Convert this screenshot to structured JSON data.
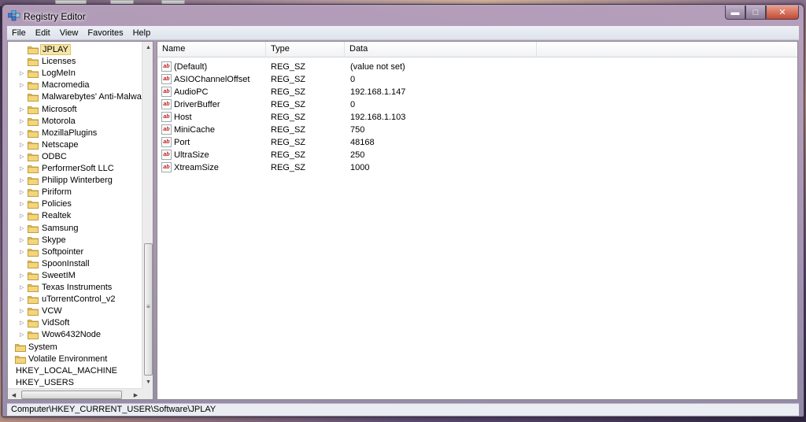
{
  "window": {
    "title": "Registry Editor"
  },
  "window_controls": {
    "minimize": "▬",
    "maximize": "□",
    "close": "✕"
  },
  "menu": [
    "File",
    "Edit",
    "View",
    "Favorites",
    "Help"
  ],
  "tree": [
    {
      "label": "JPLAY",
      "level": 1,
      "expandable": false,
      "selected": true
    },
    {
      "label": "Licenses",
      "level": 1,
      "expandable": false
    },
    {
      "label": "LogMeIn",
      "level": 1,
      "expandable": true
    },
    {
      "label": "Macromedia",
      "level": 1,
      "expandable": true
    },
    {
      "label": "Malwarebytes' Anti-Malware",
      "level": 1,
      "expandable": false
    },
    {
      "label": "Microsoft",
      "level": 1,
      "expandable": true
    },
    {
      "label": "Motorola",
      "level": 1,
      "expandable": true
    },
    {
      "label": "MozillaPlugins",
      "level": 1,
      "expandable": true
    },
    {
      "label": "Netscape",
      "level": 1,
      "expandable": true
    },
    {
      "label": "ODBC",
      "level": 1,
      "expandable": true
    },
    {
      "label": "PerformerSoft LLC",
      "level": 1,
      "expandable": true
    },
    {
      "label": "Philipp Winterberg",
      "level": 1,
      "expandable": true
    },
    {
      "label": "Piriform",
      "level": 1,
      "expandable": true
    },
    {
      "label": "Policies",
      "level": 1,
      "expandable": true
    },
    {
      "label": "Realtek",
      "level": 1,
      "expandable": true
    },
    {
      "label": "Samsung",
      "level": 1,
      "expandable": true
    },
    {
      "label": "Skype",
      "level": 1,
      "expandable": true
    },
    {
      "label": "Softpointer",
      "level": 1,
      "expandable": true
    },
    {
      "label": "SpoonInstall",
      "level": 1,
      "expandable": false
    },
    {
      "label": "SweetIM",
      "level": 1,
      "expandable": true
    },
    {
      "label": "Texas Instruments",
      "level": 1,
      "expandable": true
    },
    {
      "label": "uTorrentControl_v2",
      "level": 1,
      "expandable": true
    },
    {
      "label": "VCW",
      "level": 1,
      "expandable": true
    },
    {
      "label": "VidSoft",
      "level": 1,
      "expandable": true
    },
    {
      "label": "Wow6432Node",
      "level": 1,
      "expandable": true
    },
    {
      "label": "System",
      "level": 0,
      "expandable": false
    },
    {
      "label": "Volatile Environment",
      "level": 0,
      "expandable": false
    },
    {
      "label": "HKEY_LOCAL_MACHINE",
      "level": -1,
      "expandable": false
    },
    {
      "label": "HKEY_USERS",
      "level": -1,
      "expandable": false
    }
  ],
  "columns": [
    "Name",
    "Type",
    "Data"
  ],
  "values": [
    {
      "name": "(Default)",
      "type": "REG_SZ",
      "data": "(value not set)"
    },
    {
      "name": "ASIOChannelOffset",
      "type": "REG_SZ",
      "data": "0"
    },
    {
      "name": "AudioPC",
      "type": "REG_SZ",
      "data": "192.168.1.147"
    },
    {
      "name": "DriverBuffer",
      "type": "REG_SZ",
      "data": "0"
    },
    {
      "name": "Host",
      "type": "REG_SZ",
      "data": "192.168.1.103"
    },
    {
      "name": "MiniCache",
      "type": "REG_SZ",
      "data": "750"
    },
    {
      "name": "Port",
      "type": "REG_SZ",
      "data": "48168"
    },
    {
      "name": "UltraSize",
      "type": "REG_SZ",
      "data": "250"
    },
    {
      "name": "XtreamSize",
      "type": "REG_SZ",
      "data": "1000"
    }
  ],
  "value_icon": "ab",
  "status": {
    "path": "Computer\\HKEY_CURRENT_USER\\Software\\JPLAY"
  },
  "colors": {
    "folder": "#e8c25a",
    "selection": "#f6e5a8",
    "string_icon": "#c01818"
  }
}
